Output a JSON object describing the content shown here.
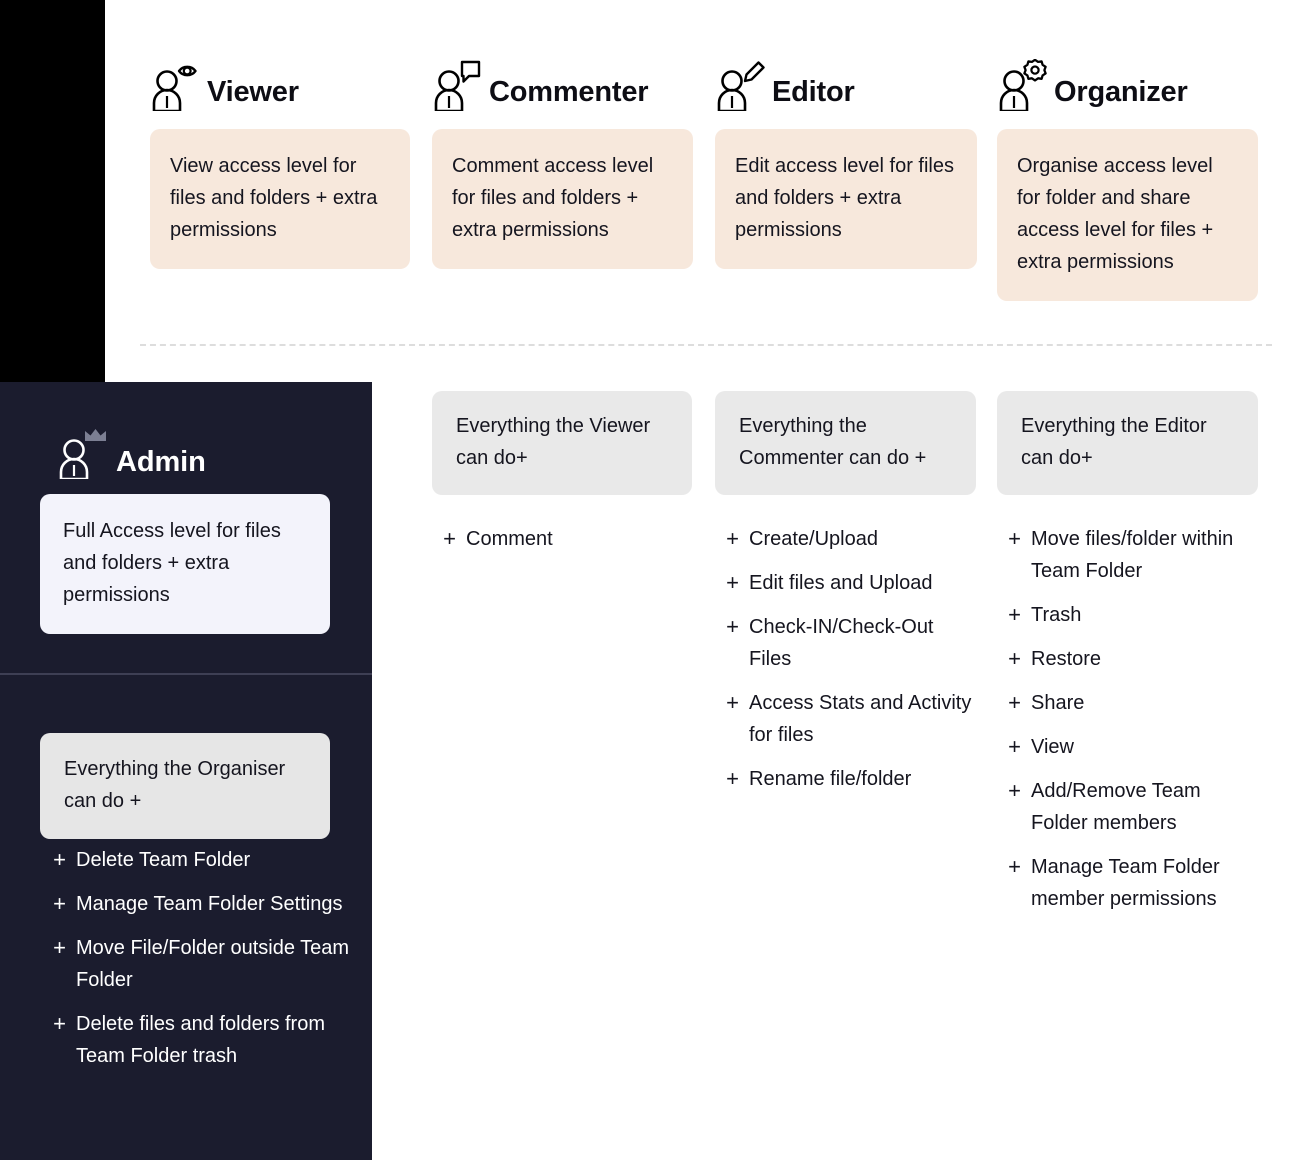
{
  "roles": [
    {
      "id": "viewer",
      "name": "Viewer",
      "icon": "person-eye-icon",
      "description": "View access level for files and folders + extra permissions"
    },
    {
      "id": "commenter",
      "name": "Commenter",
      "icon": "person-comment-icon",
      "description": "Comment access level for files and folders + extra permissions"
    },
    {
      "id": "editor",
      "name": "Editor",
      "icon": "person-pencil-icon",
      "description": "Edit access level for files and folders + extra permissions"
    },
    {
      "id": "organizer",
      "name": "Organizer",
      "icon": "person-gear-icon",
      "description": "Organise access level for folder and share access level for files + extra permissions"
    }
  ],
  "admin": {
    "name": "Admin",
    "icon": "person-crown-icon",
    "description": "Full Access level for files and folders + extra permissions",
    "inherits": "Everything the Organiser can do +",
    "permissions": [
      "Delete Team Folder",
      "Manage Team Folder Settings",
      "Move File/Folder outside Team Folder",
      "Delete files and folders from Team Folder trash"
    ]
  },
  "columns": [
    {
      "id": "commenter-perms",
      "inherits": "Everything the Viewer can do+",
      "permissions": [
        "Comment"
      ]
    },
    {
      "id": "editor-perms",
      "inherits": "Everything the Commenter can do +",
      "permissions": [
        "Create/Upload",
        "Edit files and Upload",
        "Check-IN/Check-Out Files",
        "Access Stats and Activity for files",
        "Rename file/folder"
      ]
    },
    {
      "id": "organizer-perms",
      "inherits": "Everything the Editor can do+",
      "permissions": [
        "Move files/folder within Team Folder",
        "Trash",
        "Restore",
        "Share",
        "View",
        "Add/Remove Team Folder members",
        "Manage Team Folder member permissions"
      ]
    }
  ],
  "symbols": {
    "plus": "+"
  },
  "colors": {
    "role_card_bg": "#F7E8DC",
    "inherit_card_bg": "#E9E9E9",
    "admin_panel_bg": "#1B1C2E",
    "admin_card_bg": "#F3F3FB",
    "divider": "#DDDDDD"
  }
}
